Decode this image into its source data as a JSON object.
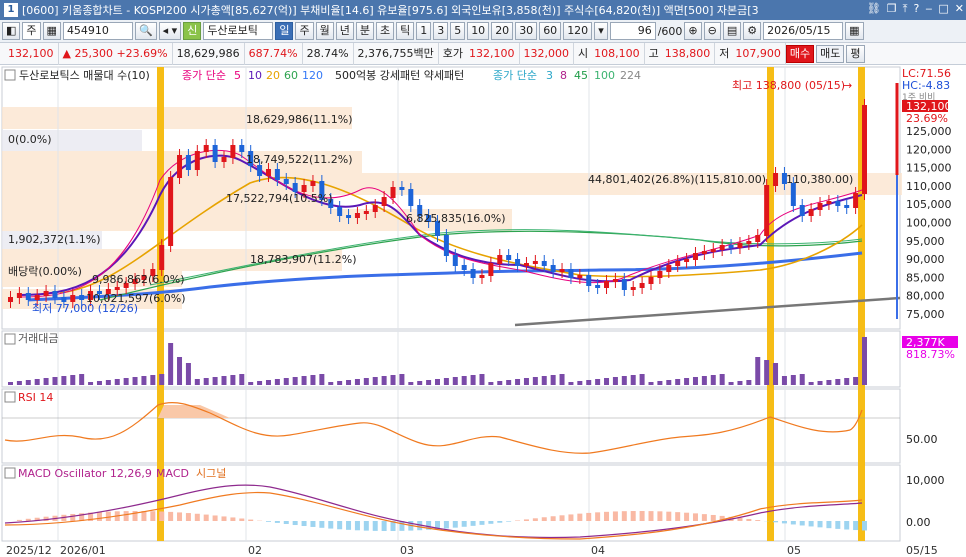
{
  "title": {
    "badge": "1",
    "text": "[0600] 키움종합차트 - KOSPI200 시가총액[85,627(억)] 부채비율[14.6] 유보율[975.6] 외국인보유[3,858(천)] 주식수[64,820(천)] 액면[500] 자본금[3"
  },
  "toolbar": {
    "mode": "주",
    "code": "454910",
    "stock_tag": "신",
    "stock_name": "두산로보틱",
    "periods": [
      "일",
      "주",
      "월",
      "년",
      "분",
      "초",
      "틱"
    ],
    "minutes": [
      "1",
      "3",
      "5",
      "10",
      "20",
      "30",
      "60",
      "120"
    ],
    "count": "96",
    "count_total": "/600",
    "date": "2026/05/15"
  },
  "quote": {
    "price": "132,100",
    "change": "25,300",
    "change_pct": "+23.69%",
    "volume": "18,629,986",
    "vol_ratio": "687.74%",
    "turnover": "28.74%",
    "amount": "2,376,755백만",
    "ask_label": "호가",
    "ask1": "132,100",
    "ask2": "132,000",
    "open_label": "시",
    "open": "108,100",
    "high_label": "고",
    "high": "138,800",
    "low_label": "저",
    "low": "107,900",
    "buy": "매수",
    "sell": "매도",
    "eval": "평"
  },
  "colors": {
    "up": "#e0161b",
    "down": "#1d4fd8",
    "highlight": "#f6bd16"
  },
  "price_panel": {
    "legend": {
      "name": "두산로보틱스 매물대 수(10)",
      "ma_label": "종가 단순",
      "ma_periods": [
        "5",
        "10",
        "20",
        "60",
        "120"
      ],
      "ma_colors": [
        "#e8007d",
        "#5b17b7",
        "#e7a300",
        "#2ea34f",
        "#3478f6"
      ],
      "pattern": "500억봉 강세패턴 약세패턴",
      "ma2_label": "종가 단순",
      "ma2_periods": [
        "3",
        "8",
        "45",
        "100",
        "224"
      ],
      "ma2_colors": [
        "#2aa6c8",
        "#b0228c",
        "#1f9c48",
        "#3cb371",
        "#888888"
      ]
    },
    "right_labels": {
      "lc": "LC:71.56",
      "hc": "HC:-4.83",
      "hc2": "1주 비비",
      "last": "132,100",
      "pct": "23.69%"
    },
    "y_ticks": [
      "125,000",
      "120,000",
      "115,000",
      "110,000",
      "105,000",
      "100,000",
      "95,000",
      "90,000",
      "85,000",
      "80,000",
      "75,000"
    ],
    "annotations": {
      "max": "최고 138,800 (05/15)",
      "min": "최저 77,000 (12/26)",
      "v1": "18,629,986(11.1%)",
      "v2": "0(0.0%)",
      "v3": "18,749,522(11.2%)",
      "v4": "17,522,794(10.5%)",
      "v5": "44,801,402(26.8%)(115,810.00)",
      "v6": "110,380.00)",
      "v7": "1,902,372(1.1%)",
      "v8": "6,825,835(16.0%)",
      "v9": "18,783,907(11.2%)",
      "v10": "배당락(0.00%)",
      "v11": "9,986,862(6.0%)",
      "v12": "10,021,597(6.0%)"
    }
  },
  "volume_panel": {
    "label": "거래대금",
    "value": "2,377K",
    "pct": "818.73%"
  },
  "rsi_panel": {
    "label": "RSI 14",
    "tick": "50.00"
  },
  "macd_panel": {
    "label": "MACD Oscillator 12,26,9",
    "macd": "MACD",
    "signal": "시그널",
    "ticks": [
      "10,000",
      "0.00"
    ]
  },
  "x_axis": [
    "2025/12",
    "2026/01",
    "02",
    "03",
    "04",
    "05",
    "05/15"
  ]
}
